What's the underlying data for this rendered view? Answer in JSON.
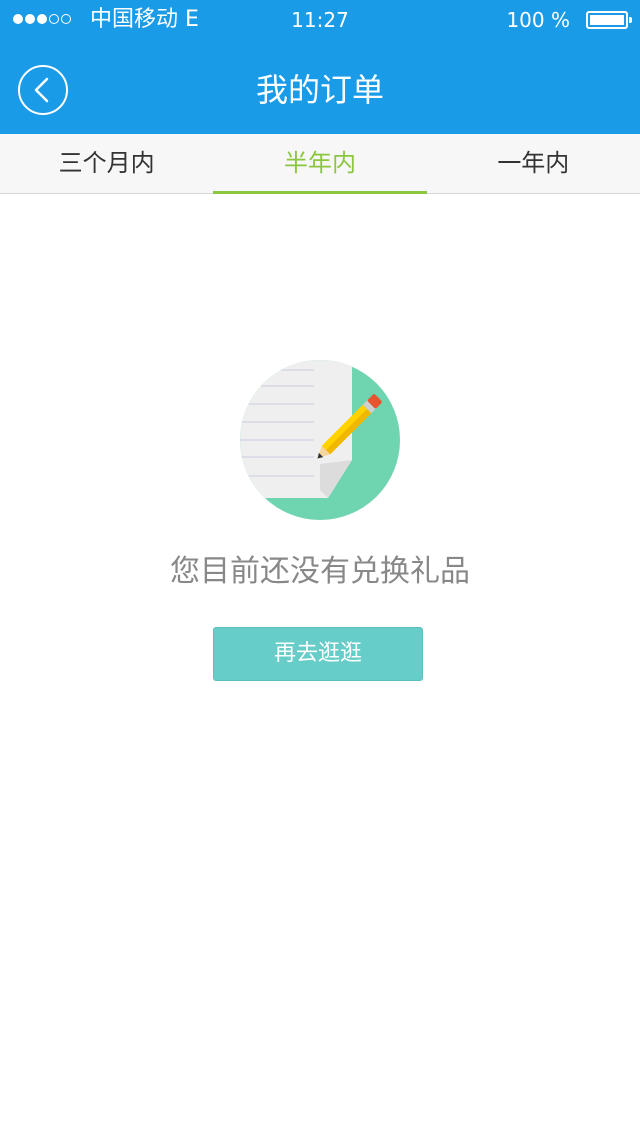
{
  "status_bar": {
    "signal_dots": [
      true,
      true,
      true,
      false,
      false
    ],
    "carrier": "中国移动 E",
    "time": "11:27",
    "battery_percent": "100 %"
  },
  "header": {
    "title": "我的订单",
    "back_icon": "chevron-left-icon"
  },
  "tabs": [
    {
      "label": "三个月内",
      "active": false
    },
    {
      "label": "半年内",
      "active": true
    },
    {
      "label": "一年内",
      "active": false
    }
  ],
  "empty_state": {
    "icon": "note-pencil-icon",
    "message": "您目前还没有兑换礼品",
    "button_label": "再去逛逛"
  },
  "colors": {
    "primary": "#1a9be8",
    "tab_active": "#8cc63f",
    "button": "#66cdc9",
    "illustration_green": "#6fd4b0"
  }
}
